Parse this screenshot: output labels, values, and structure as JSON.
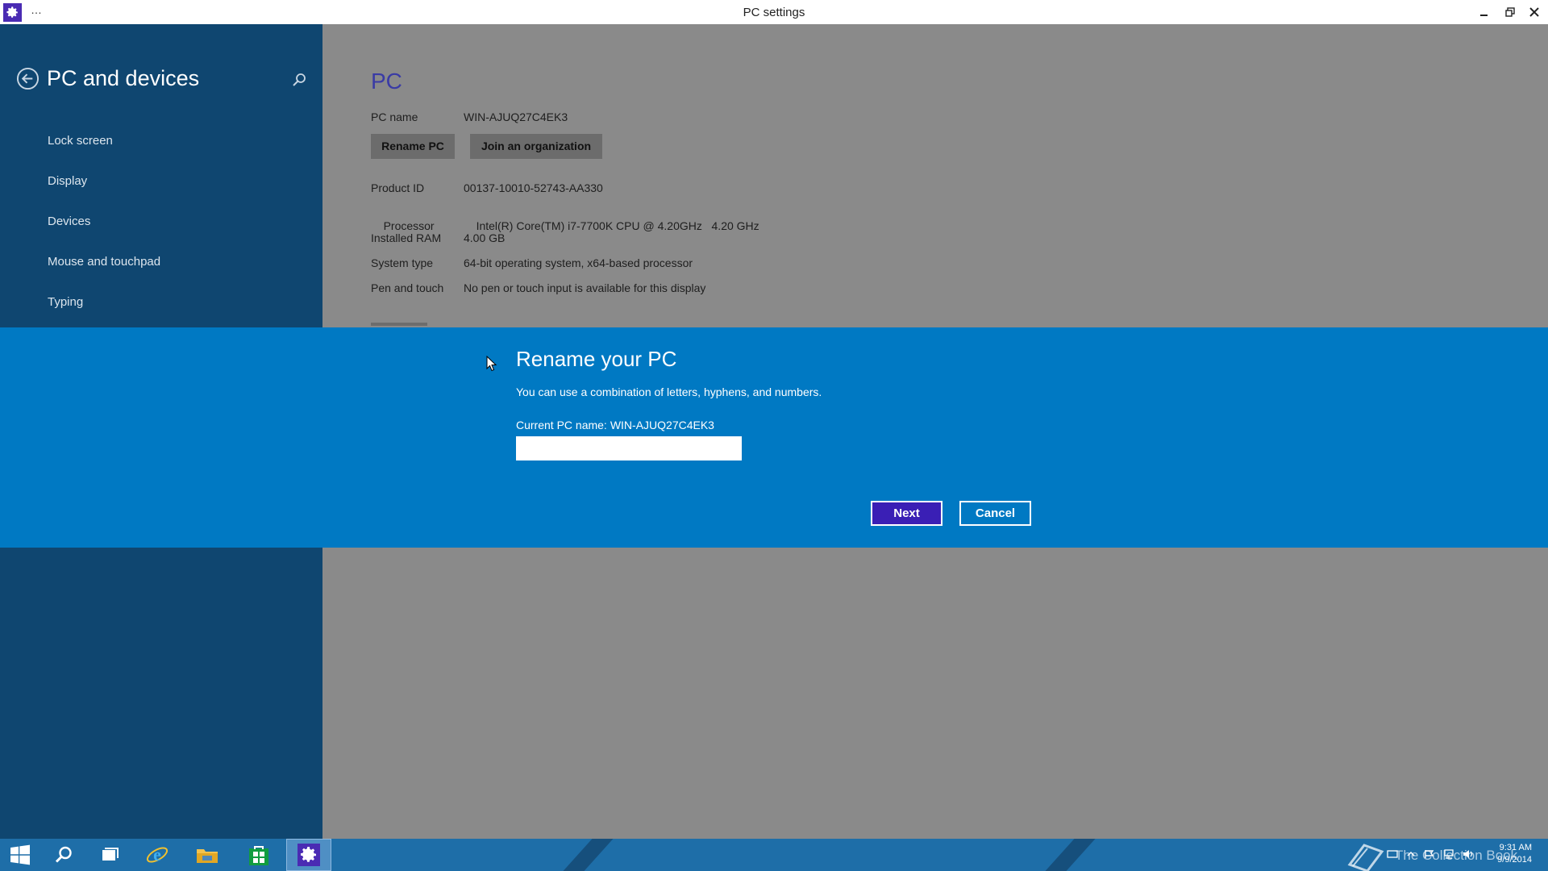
{
  "window": {
    "title": "PC settings",
    "menu_glyph": "…"
  },
  "nav": {
    "header": "PC and devices",
    "items": [
      {
        "label": "Lock screen"
      },
      {
        "label": "Display"
      },
      {
        "label": "Devices"
      },
      {
        "label": "Mouse and touchpad"
      },
      {
        "label": "Typing"
      }
    ]
  },
  "pc": {
    "section_title": "PC",
    "pc_name_label": "PC name",
    "pc_name_value": "WIN-AJUQ27C4EK3",
    "rename_button": "Rename PC",
    "join_button": "Join an organization",
    "specs": [
      {
        "label": "Product ID",
        "value": "00137-10010-52743-AA330"
      },
      {
        "label": "Processor",
        "value": "Intel(R) Core(TM) i7-7700K CPU @ 4.20GHz   4.20 GHz"
      },
      {
        "label": "Installed RAM",
        "value": "4.00 GB"
      },
      {
        "label": "System type",
        "value": "64-bit operating system, x64-based processor"
      },
      {
        "label": "Pen and touch",
        "value": "No pen or touch input is available for this display"
      }
    ]
  },
  "dialog": {
    "title": "Rename your PC",
    "subtitle": "You can use a combination of letters, hyphens, and numbers.",
    "current_label": "Current PC name:",
    "current_value": "WIN-AJUQ27C4EK3",
    "input_value": "",
    "next_label": "Next",
    "cancel_label": "Cancel"
  },
  "taskbar": {
    "watermark": "The Collection Book",
    "time": "9:31 AM",
    "date": "9/9/2014"
  },
  "colors": {
    "nav_bg": "#0f4670",
    "dialog_bg": "#0079c3",
    "accent_purple": "#3a1fb5",
    "taskbar_bg": "#1e6ea8"
  }
}
